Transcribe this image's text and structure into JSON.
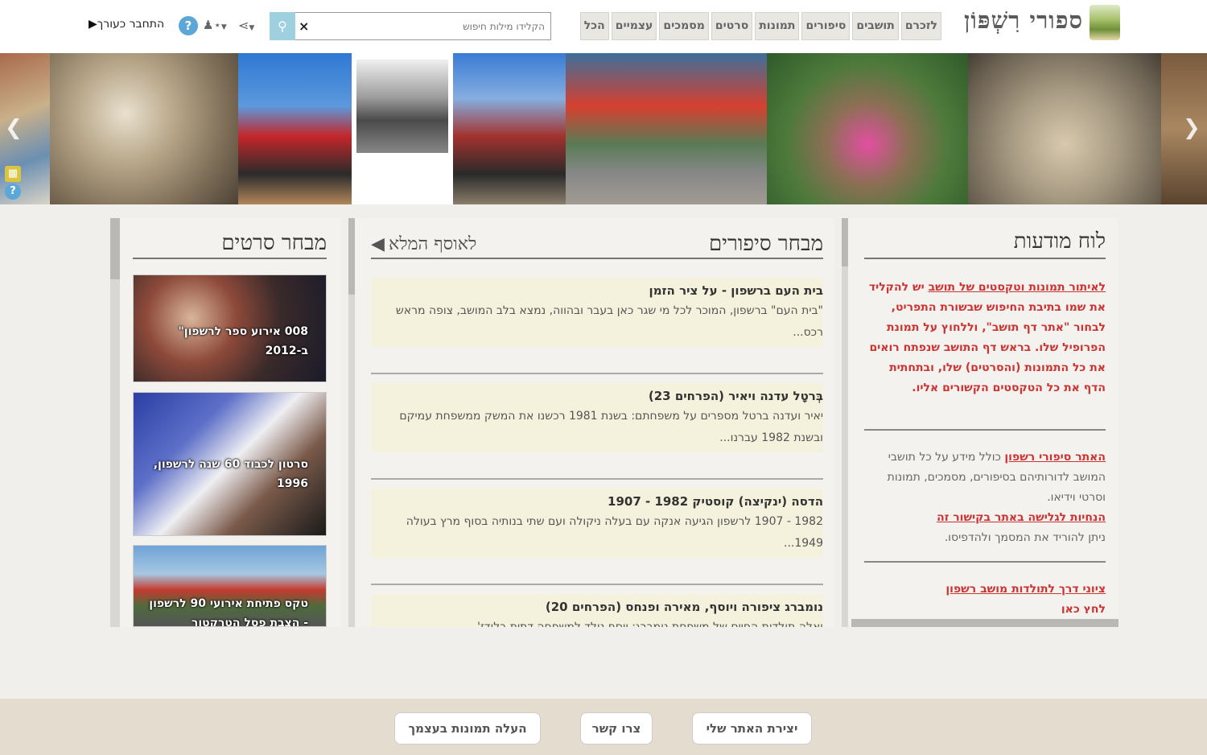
{
  "header": {
    "logo_text": "ספורי רִשְׁפּוֹן",
    "nav": [
      "לזכרם",
      "תושבים",
      "סיפורים",
      "תמונות",
      "סרטים",
      "מסמכים",
      "עצמיים",
      "הכל"
    ],
    "search_placeholder": "הקלידו מילות חיפוש",
    "search_clear": "×",
    "login_label": "התחבר כעורך",
    "help_label": "?"
  },
  "strip": {
    "photos": [
      "tractor-ride",
      "family-tractor",
      "red-tractor-girl",
      "old-house-girl",
      "red-tractor-wheels",
      "red-machine-exhibit",
      "kids-bicycles",
      "baby-washtub"
    ]
  },
  "notice_board": {
    "title": "לוח מודעות",
    "p1_link": "לאיתור תמונות וטקסטים של תושב",
    "p1_text": " יש להקליד את שמו בתיבת החיפוש שבשורת התפריט, לבחור \"אתר דף תושב\", וללחוץ על תמונת הפרופיל שלו. בראש דף התושב שנפתח רואים את כל התמונות (והסרטים) שלו, ובתחתית הדף את כל הטקסטים הקשורים אליו.",
    "p2_link": "האתר סיפורי רשפון",
    "p2_text": " כולל מידע על כל תושבי המושב לדורותיהם בסיפורים, מסמכים, תמונות וסרטי וידיאו.",
    "p3_link": "הנחיות לגלישה באתר בקישור זה",
    "p3_text": "ניתן להוריד את המסמך ולהדפיסו.",
    "p4_link": "ציוני דרך לתולדות מושב רשפון",
    "p5_link": "לחץ כאן"
  },
  "stories_panel": {
    "title": "מבחר סיפורים",
    "archive_link": "לאוסף המלא",
    "items": [
      {
        "title": "בית העם ברשפון - על ציר הזמן",
        "text": "\"בית העם\" ברשפון, המוכר לכל מי שגר כאן בעבר ובהווה, נמצא בלב המושב, צופה מראש רכס..."
      },
      {
        "title": "בְּרטָל עדנה ויאיר (הפרחים 23)",
        "text": "יאיר ועדנה ברטל מספרים על משפחתם: בשנת 1981 רכשנו את המשק ממשפחת עמיקם ובשנת 1982 עברנו..."
      },
      {
        "title": "הדסה (ינקיצה) קוסטיק 1982 - 1907",
        "text": "1982 - 1907 לרשפון הגיעה אנקה עם בעלה ניקולה ועם שתי בנותיה בסוף מרץ בעולה 1949..."
      },
      {
        "title": "נומברג ציפורה ויוסף, מאירה ופנחס (הפרחים 20)",
        "text": "ואלה תולדות החיים של משפחת נומברג: יוסף נולד למשפחה דתית בלודז'..."
      }
    ]
  },
  "films_panel": {
    "title": "מבחר סרטים",
    "items": [
      {
        "line1": "008 אירוע ספר לרשפון\"",
        "line2": "ב-2012"
      },
      {
        "line1": "סרטון לכבוד 60 שנה לרשפון,",
        "line2": "1996"
      },
      {
        "line1": "טקס פתיחת אירועי 90 לרשפון",
        "line2": "- הצבת פסל הטרקטור"
      }
    ]
  },
  "footer": {
    "buttons": [
      "יצירת האתר שלי",
      "צרו קשר",
      "העלה תמונות בעצמך"
    ]
  }
}
